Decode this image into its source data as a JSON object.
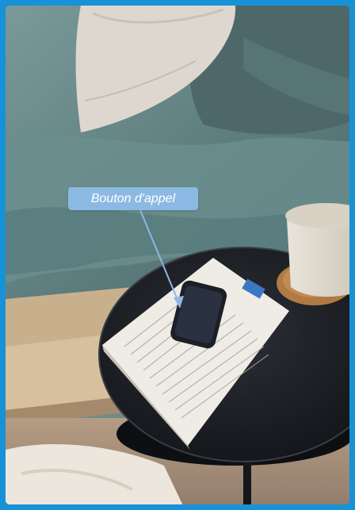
{
  "annotation": {
    "label": "Bouton d'appel",
    "color": "#8cb9e4"
  },
  "frame": {
    "border_color": "#1792d6"
  },
  "scene": {
    "objects": [
      "bed-with-teal-duvet",
      "white-pillow",
      "wooden-bed-frame",
      "round-black-side-table",
      "open-book",
      "smartphone",
      "white-mug-on-wooden-coaster",
      "white-rug"
    ]
  }
}
